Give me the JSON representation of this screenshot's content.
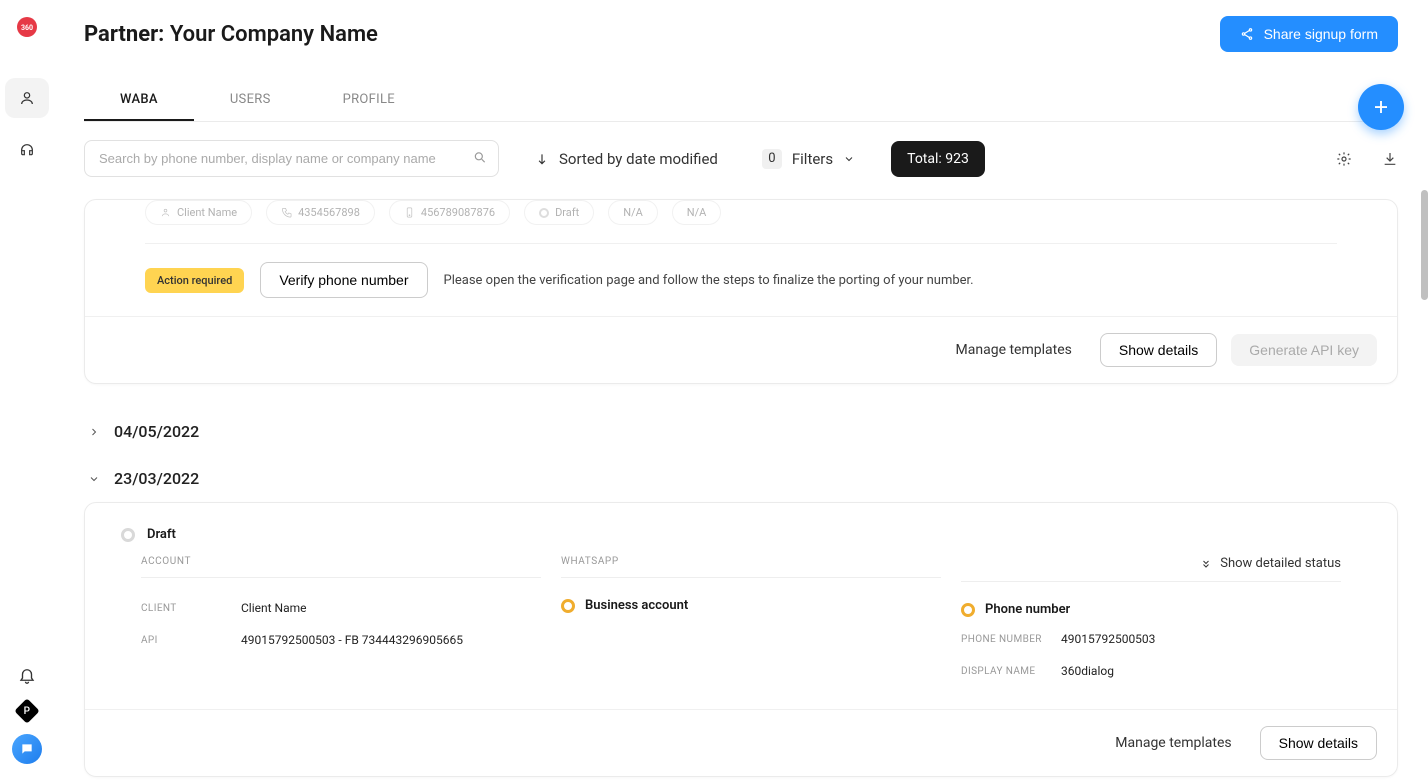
{
  "page": {
    "title_prefix": "Partner:",
    "company": "Your Company Name"
  },
  "header": {
    "share_btn": "Share signup form"
  },
  "tabs": [
    {
      "label": "WABA",
      "active": true
    },
    {
      "label": "USERS",
      "active": false
    },
    {
      "label": "PROFILE",
      "active": false
    }
  ],
  "toolbar": {
    "search_placeholder": "Search by phone number, display name or company name",
    "sort_label": "Sorted by date modified",
    "filters_label": "Filters",
    "filters_count": "0",
    "total_label": "Total: 923"
  },
  "card1": {
    "chips": {
      "client": "Client Name",
      "phone1": "4354567898",
      "phone2": "456789087876",
      "status": "Draft",
      "na1": "N/A",
      "na2": "N/A"
    },
    "badge": "Action required",
    "verify_btn": "Verify phone number",
    "verify_text": "Please open the verification page and follow the steps to finalize the porting of your number.",
    "footer": {
      "manage": "Manage templates",
      "show": "Show details",
      "generate": "Generate API key"
    }
  },
  "sections": [
    {
      "date": "04/05/2022",
      "expanded": false
    },
    {
      "date": "23/03/2022",
      "expanded": true
    }
  ],
  "card2": {
    "status": "Draft",
    "account_header": "ACCOUNT",
    "whatsapp_header": "WHATSAPP",
    "detailed_status": "Show detailed status",
    "client_label": "CLIENT",
    "client_value": "Client Name",
    "api_label": "API",
    "api_value": "49015792500503 - FB 734443296905665",
    "ba_label": "Business account",
    "pn_badge": "Phone number",
    "phone_label": "PHONE NUMBER",
    "phone_value": "49015792500503",
    "display_label": "DISPLAY NAME",
    "display_value": "360dialog",
    "footer": {
      "manage": "Manage templates",
      "show": "Show details"
    }
  }
}
